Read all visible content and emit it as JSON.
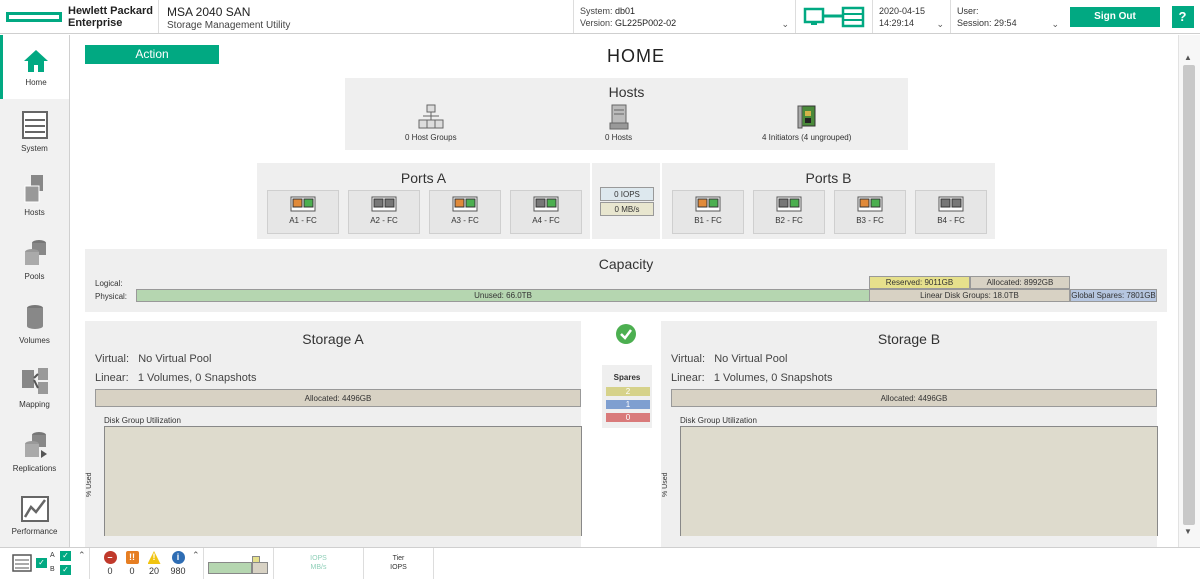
{
  "header": {
    "brand_line1": "Hewlett Packard",
    "brand_line2": "Enterprise",
    "product_name": "MSA 2040 SAN",
    "product_subtitle": "Storage Management Utility",
    "system_label": "System:",
    "system_value": "db01",
    "version_label": "Version:",
    "version_value": "GL225P002-02",
    "date": "2020-04-15",
    "time": "14:29:14",
    "user_label": "User:",
    "user_value": "",
    "session_label": "Session:",
    "session_value": "29:54",
    "sign_out_label": "Sign Out",
    "help_label": "?"
  },
  "sidebar": {
    "items": [
      {
        "label": "Home",
        "icon": "home-icon"
      },
      {
        "label": "System",
        "icon": "system-icon"
      },
      {
        "label": "Hosts",
        "icon": "hosts-icon"
      },
      {
        "label": "Pools",
        "icon": "pools-icon"
      },
      {
        "label": "Volumes",
        "icon": "volumes-icon"
      },
      {
        "label": "Mapping",
        "icon": "mapping-icon"
      },
      {
        "label": "Replications",
        "icon": "replications-icon"
      },
      {
        "label": "Performance",
        "icon": "performance-icon"
      }
    ]
  },
  "main": {
    "action_label": "Action",
    "page_title": "HOME",
    "hosts": {
      "title": "Hosts",
      "host_groups": "0 Host Groups",
      "hosts_count": "0 Hosts",
      "initiators": "4 Initiators (4 ungrouped)"
    },
    "ports_a": {
      "title": "Ports A",
      "ports": [
        "A1 - FC",
        "A2 - FC",
        "A3 - FC",
        "A4 - FC"
      ]
    },
    "ports_b": {
      "title": "Ports B",
      "ports": [
        "B1 - FC",
        "B2 - FC",
        "B3 - FC",
        "B4 - FC"
      ]
    },
    "perf": {
      "iops": "0 IOPS",
      "mbs": "0 MB/s"
    },
    "capacity": {
      "title": "Capacity",
      "logical_label": "Logical:",
      "physical_label": "Physical:",
      "reserved": "Reserved: 9011GB",
      "allocated": "Allocated: 8992GB",
      "unused": "Unused: 66.0TB",
      "linear_disk_groups": "Linear Disk Groups: 18.0TB",
      "global_spares": "Global Spares: 7801GB"
    },
    "storage_a": {
      "title": "Storage A",
      "virtual_label": "Virtual:",
      "virtual_value": "No Virtual Pool",
      "linear_label": "Linear:",
      "linear_value": "1 Volumes, 0 Snapshots",
      "allocated": "Allocated: 4496GB",
      "dgu_label": "Disk Group Utilization",
      "pct_label": "% Used"
    },
    "storage_b": {
      "title": "Storage B",
      "virtual_label": "Virtual:",
      "virtual_value": "No Virtual Pool",
      "linear_label": "Linear:",
      "linear_value": "1 Volumes, 0 Snapshots",
      "allocated": "Allocated: 4496GB",
      "dgu_label": "Disk Group Utilization",
      "pct_label": "% Used"
    },
    "spares": {
      "title": "Spares",
      "values": [
        "2",
        "1",
        "0"
      ],
      "colors": [
        "#d6d28a",
        "#7f9fd0",
        "#d97a7a"
      ]
    }
  },
  "footer": {
    "controller_a": "A",
    "controller_b": "B",
    "alerts": [
      {
        "count": "0",
        "color": "#c0392b",
        "icon": "critical-icon"
      },
      {
        "count": "0",
        "color": "#e67e22",
        "icon": "error-icon"
      },
      {
        "count": "20",
        "color": "#f1c40f",
        "icon": "warning-icon"
      },
      {
        "count": "980",
        "color": "#2e6db4",
        "icon": "info-icon"
      }
    ],
    "iops_label": "IOPS",
    "mbs_label": "MB/s",
    "tier_label": "Tier",
    "tier_sub": "IOPS"
  },
  "colors": {
    "accent": "#01a982",
    "panel": "#efefef",
    "unused_bar": "#b5d6b0",
    "reserved_bar": "#e6e08c",
    "allocated_bar": "#d8d2c4",
    "spares_bar": "#b6c6e0"
  }
}
